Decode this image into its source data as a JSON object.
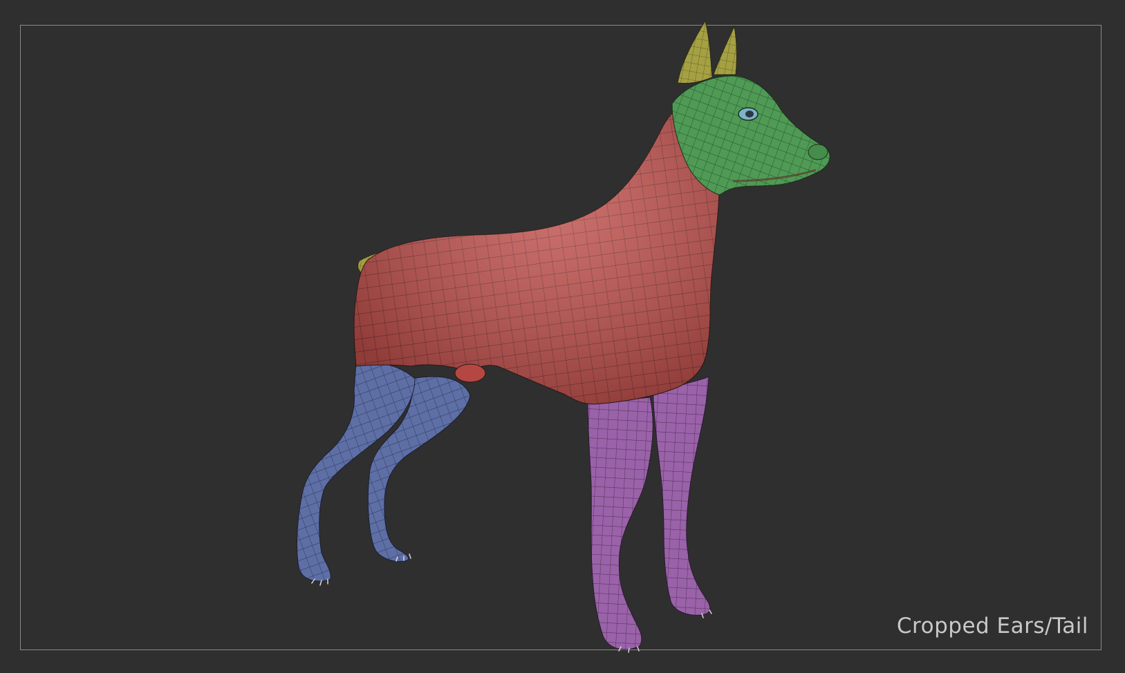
{
  "caption": "Cropped Ears/Tail",
  "colors": {
    "background": "#2f2f2f",
    "frame": "#8a8a8a",
    "caption": "#c9c9c9",
    "torso_group": "#c0504c",
    "head_group": "#4f9a55",
    "ears_tail_group": "#a5a143",
    "front_legs_group": "#9a62a8",
    "hind_legs_group": "#5e6fa6",
    "wireframe": "#1f1f1f",
    "eye": "#7fb2c8"
  },
  "model": {
    "subject": "dog-model",
    "polygroups": [
      "torso",
      "head",
      "ears",
      "tail",
      "front-legs",
      "hind-legs"
    ]
  }
}
